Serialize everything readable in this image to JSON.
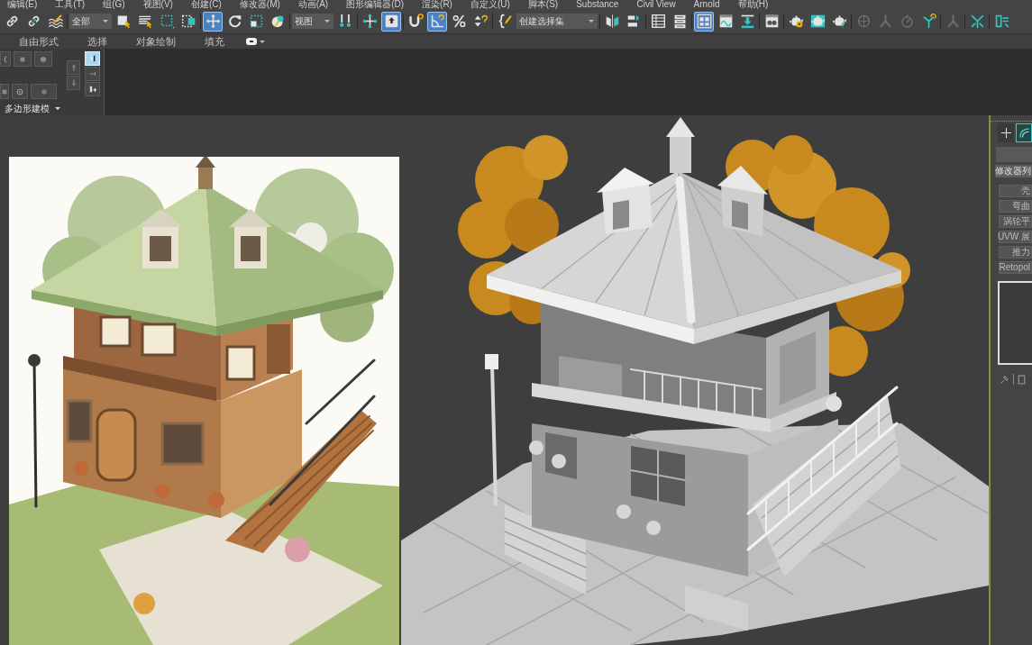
{
  "menu_bar": {
    "items": [
      "编辑(E)",
      "工具(T)",
      "组(G)",
      "视图(V)",
      "创建(C)",
      "修改器(M)",
      "动画(A)",
      "图形编辑器(D)",
      "渲染(R)",
      "自定义(U)",
      "脚本(S)",
      "Substance",
      "Civil View",
      "Arnold",
      "帮助(H)"
    ]
  },
  "main_toolbar": {
    "groups": [
      {
        "items": [
          {
            "kind": "button",
            "selected": false,
            "disabled": false
          },
          {
            "kind": "button",
            "selected": false,
            "disabled": false
          },
          {
            "kind": "button",
            "selected": false,
            "disabled": false
          }
        ]
      },
      {
        "items": [
          {
            "kind": "dropdown",
            "value": "全部"
          },
          {
            "kind": "button",
            "selected": false,
            "disabled": false
          },
          {
            "kind": "button",
            "selected": false,
            "disabled": false
          },
          {
            "kind": "button",
            "selected": false,
            "disabled": false
          },
          {
            "kind": "button",
            "selected": false,
            "disabled": false
          }
        ]
      },
      {
        "items": [
          {
            "kind": "button",
            "selected": true,
            "disabled": false
          },
          {
            "kind": "button",
            "selected": false,
            "disabled": false
          },
          {
            "kind": "button",
            "selected": false,
            "disabled": false
          },
          {
            "kind": "button",
            "selected": false,
            "disabled": false
          }
        ]
      },
      {
        "items": [
          {
            "kind": "dropdown",
            "value": "视图"
          },
          {
            "kind": "button",
            "selected": false,
            "disabled": false
          }
        ]
      },
      {
        "items": [
          {
            "kind": "button",
            "selected": false,
            "disabled": false
          },
          {
            "kind": "button",
            "selected": true,
            "disabled": false
          }
        ]
      },
      {
        "items": [
          {
            "kind": "button",
            "selected": false,
            "disabled": false
          },
          {
            "kind": "button",
            "selected": true,
            "disabled": false
          },
          {
            "kind": "button",
            "selected": false,
            "disabled": false
          },
          {
            "kind": "button",
            "selected": false,
            "disabled": false
          }
        ]
      },
      {
        "items": [
          {
            "kind": "button",
            "selected": false,
            "disabled": false
          },
          {
            "kind": "dropdown",
            "value": "创建选择集"
          }
        ]
      },
      {
        "items": [
          {
            "kind": "button",
            "selected": false,
            "disabled": false
          },
          {
            "kind": "button",
            "selected": false,
            "disabled": false
          }
        ]
      },
      {
        "items": [
          {
            "kind": "button",
            "selected": false,
            "disabled": false
          },
          {
            "kind": "button",
            "selected": false,
            "disabled": false
          }
        ]
      },
      {
        "items": [
          {
            "kind": "button",
            "selected": true,
            "disabled": false
          },
          {
            "kind": "button",
            "selected": false,
            "disabled": false
          },
          {
            "kind": "button",
            "selected": false,
            "disabled": false
          }
        ]
      },
      {
        "items": [
          {
            "kind": "button",
            "selected": false,
            "disabled": false
          }
        ]
      },
      {
        "items": [
          {
            "kind": "button",
            "selected": false,
            "disabled": false
          },
          {
            "kind": "button",
            "selected": false,
            "disabled": false
          },
          {
            "kind": "button",
            "selected": false,
            "disabled": false
          }
        ]
      },
      {
        "items": [
          {
            "kind": "button",
            "selected": false,
            "disabled": true
          },
          {
            "kind": "button",
            "selected": false,
            "disabled": true
          },
          {
            "kind": "button",
            "selected": false,
            "disabled": true
          },
          {
            "kind": "button",
            "selected": false,
            "disabled": false
          }
        ]
      },
      {
        "items": [
          {
            "kind": "button",
            "selected": false,
            "disabled": true
          }
        ]
      },
      {
        "items": [
          {
            "kind": "button",
            "selected": false,
            "disabled": false
          }
        ]
      },
      {
        "items": [
          {
            "kind": "button",
            "selected": false,
            "disabled": false
          }
        ]
      }
    ]
  },
  "ribbon": {
    "tabs": [
      {
        "label": "自由形式",
        "selected": false
      },
      {
        "label": "选择",
        "selected": false
      },
      {
        "label": "对象绘制",
        "selected": false
      },
      {
        "label": "填充",
        "selected": false
      }
    ],
    "panel": {
      "title": "多边形建模",
      "buttons": [
        {
          "selected": false
        },
        {
          "selected": false
        },
        {
          "selected": false
        },
        {
          "selected": false
        },
        {
          "selected": false
        },
        {
          "selected": false
        },
        {
          "selected": false
        },
        {
          "selected": false
        },
        {
          "selected": true
        },
        {
          "selected": false
        },
        {
          "selected": false
        }
      ]
    }
  },
  "command_panel": {
    "tabs": [
      {
        "selected": false
      },
      {
        "selected": true
      }
    ],
    "modifier_list": {
      "value": "修改器列"
    },
    "modifier_buttons": [
      "壳",
      "弯曲",
      "涡轮平",
      "UVW 展",
      "推力",
      "Retopol"
    ]
  }
}
